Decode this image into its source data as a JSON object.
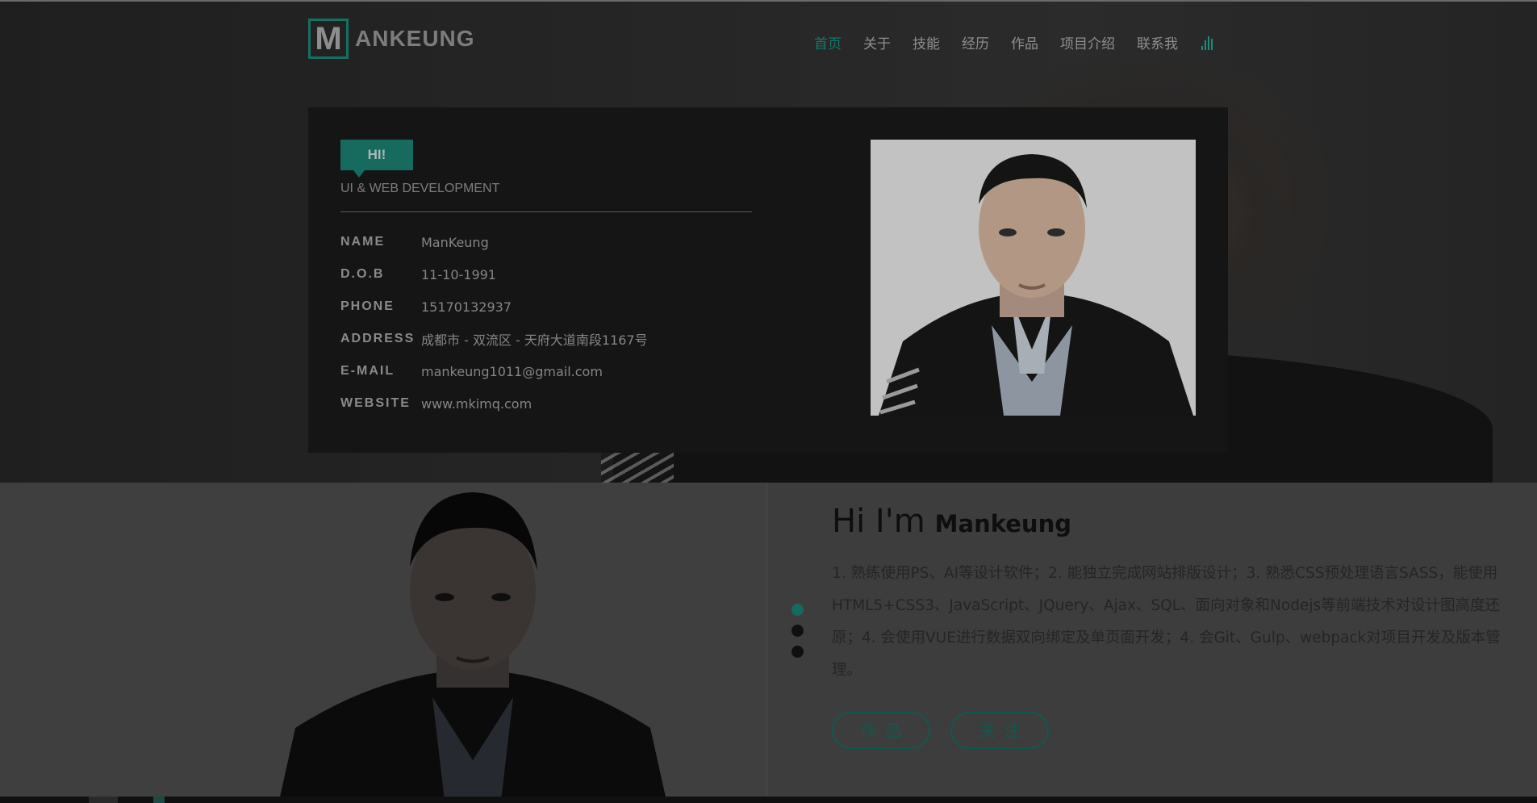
{
  "nav": {
    "logo_letter": "M",
    "logo_text": "ANKEUNG",
    "items": [
      {
        "label": "首页",
        "active": true
      },
      {
        "label": "关于"
      },
      {
        "label": "技能"
      },
      {
        "label": "经历"
      },
      {
        "label": "作品"
      },
      {
        "label": "项目介绍"
      },
      {
        "label": "联系我"
      }
    ],
    "music_icon": "equalizer-icon"
  },
  "profile": {
    "badge": "HI!",
    "subtitle": "UI & WEB DEVELOPMENT",
    "fields": [
      {
        "label": "NAME",
        "value": "ManKeung"
      },
      {
        "label": "D.O.B",
        "value": "11-10-1991"
      },
      {
        "label": "PHONE",
        "value": "15170132937"
      },
      {
        "label": "ADDRESS",
        "value": "成都市 - 双流区 - 天府大道南段1167号"
      },
      {
        "label": "E-MAIL",
        "value": "mankeung1011@gmail.com"
      },
      {
        "label": "WEBSITE",
        "value": "www.mkimq.com"
      }
    ]
  },
  "about": {
    "greeting": "Hi I'm",
    "name": "Mankeung",
    "description": "1. 熟练使用PS、AI等设计软件；2. 能独立完成网站排版设计；3. 熟悉CSS预处理语言SASS，能使用HTML5+CSS3、JavaScript、JQuery、Ajax、SQL、面向对象和Nodejs等前端技术对设计图高度还原；4. 会使用VUE进行数据双向绑定及单页面开发；4. 会Git、Gulp、webpack对项目开发及版本管理。",
    "buttons": [
      "作品",
      "关注"
    ]
  },
  "colors": {
    "accent": "#15796b",
    "overlay": "#000000"
  }
}
